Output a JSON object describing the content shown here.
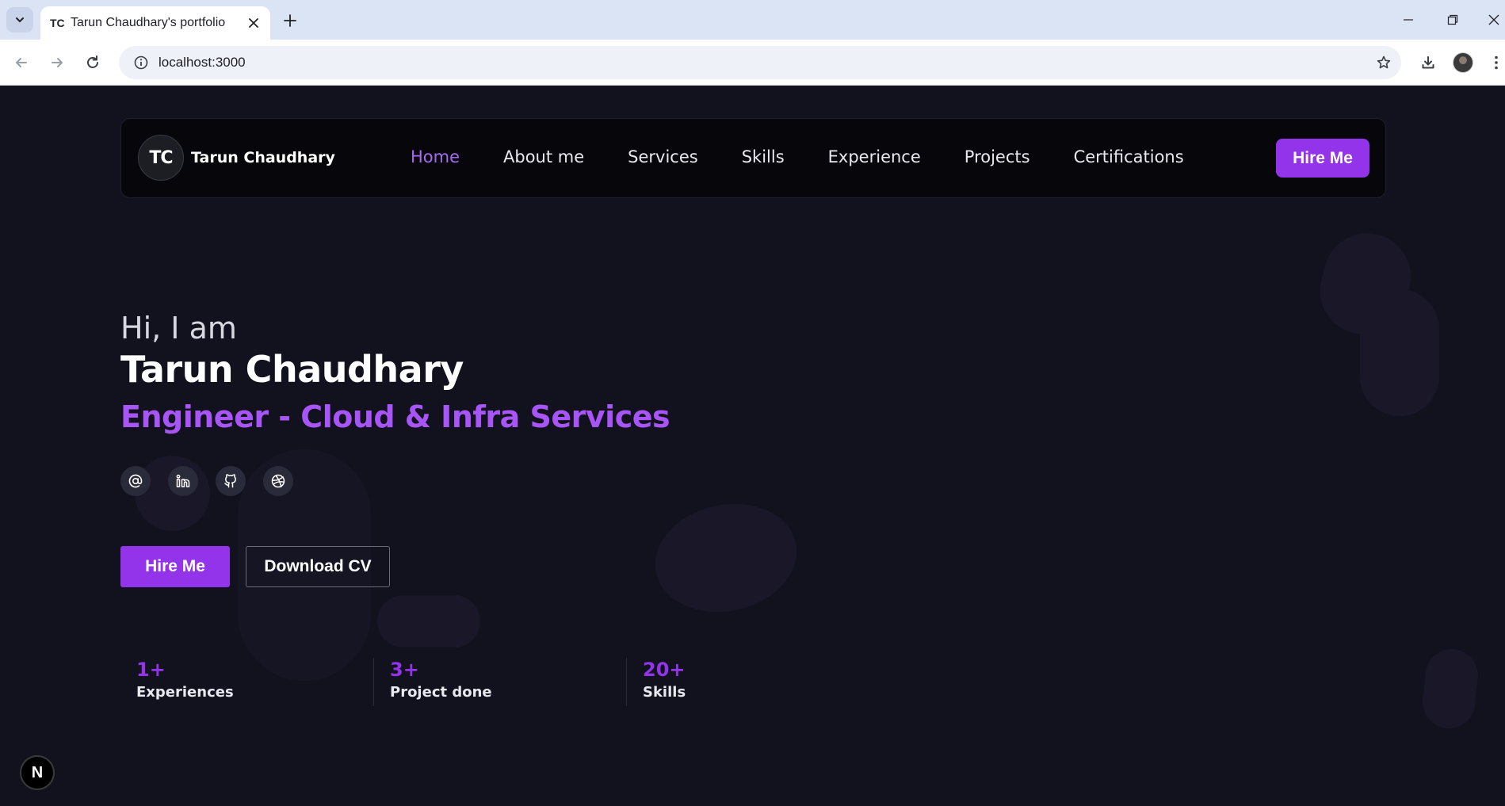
{
  "browser": {
    "tab_favicon": "TC",
    "tab_title": "Tarun Chaudhary's portfolio",
    "url": "localhost:3000"
  },
  "navbar": {
    "logo": "TC",
    "brand_name": "Tarun Chaudhary",
    "links": [
      {
        "label": "Home",
        "active": true
      },
      {
        "label": "About me"
      },
      {
        "label": "Services"
      },
      {
        "label": "Skills"
      },
      {
        "label": "Experience"
      },
      {
        "label": "Projects"
      },
      {
        "label": "Certifications"
      }
    ],
    "hire_label": "Hire Me"
  },
  "hero": {
    "greeting": "Hi, I am",
    "name": "Tarun Chaudhary",
    "role": "Engineer - Cloud & Infra Services",
    "socials": [
      "at-sign-icon",
      "linkedin-icon",
      "github-icon",
      "dribbble-icon"
    ],
    "hire_label": "Hire Me",
    "cv_label": "Download CV"
  },
  "stats": [
    {
      "value": "1+",
      "label": "Experiences"
    },
    {
      "value": "3+",
      "label": "Project done"
    },
    {
      "value": "20+",
      "label": "Skills"
    }
  ],
  "dev_badge": "N",
  "colors": {
    "accent": "#9333ea",
    "accent_text": "#a855f7",
    "background": "#12121f",
    "navbar_bg": "#07070b"
  }
}
